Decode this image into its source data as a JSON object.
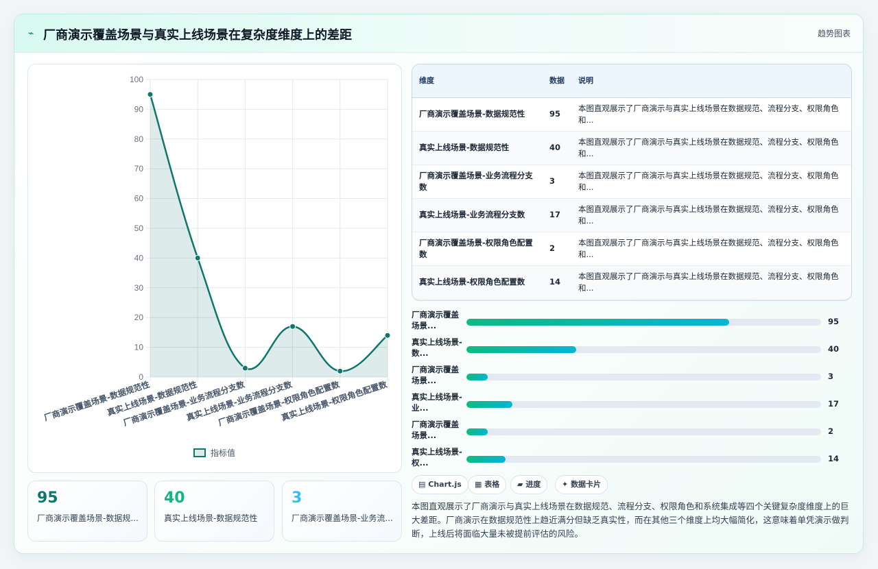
{
  "header": {
    "icon": "line-chart-icon",
    "title": "厂商演示覆盖场景与真实上线场景在复杂度维度上的差距",
    "tag": "趋势图表"
  },
  "chart_data": {
    "type": "line",
    "categories": [
      "厂商演示覆盖场景-数据规范性",
      "真实上线场景-数据规范性",
      "厂商演示覆盖场景-业务流程分支数",
      "真实上线场景-业务流程分支数",
      "厂商演示覆盖场景-权限角色配置数",
      "真实上线场景-权限角色配置数"
    ],
    "series": [
      {
        "name": "指标值",
        "values": [
          95,
          40,
          3,
          17,
          2,
          14
        ]
      }
    ],
    "ylim": [
      0,
      100
    ],
    "yticks": [
      0,
      10,
      20,
      30,
      40,
      50,
      60,
      70,
      80,
      90,
      100
    ],
    "grid": true,
    "fill": true,
    "legend": "bottom",
    "color": "#0f766e"
  },
  "table": {
    "headers": [
      "维度",
      "数据",
      "说明"
    ],
    "rows": [
      {
        "dim": "厂商演示覆盖场景-数据规范性",
        "value": "95",
        "desc": "本图直观展示了厂商演示与真实上线场景在数据规范、流程分支、权限角色和..."
      },
      {
        "dim": "真实上线场景-数据规范性",
        "value": "40",
        "desc": "本图直观展示了厂商演示与真实上线场景在数据规范、流程分支、权限角色和..."
      },
      {
        "dim": "厂商演示覆盖场景-业务流程分支数",
        "value": "3",
        "desc": "本图直观展示了厂商演示与真实上线场景在数据规范、流程分支、权限角色和..."
      },
      {
        "dim": "真实上线场景-业务流程分支数",
        "value": "17",
        "desc": "本图直观展示了厂商演示与真实上线场景在数据规范、流程分支、权限角色和..."
      },
      {
        "dim": "厂商演示覆盖场景-权限角色配置数",
        "value": "2",
        "desc": "本图直观展示了厂商演示与真实上线场景在数据规范、流程分支、权限角色和..."
      },
      {
        "dim": "真实上线场景-权限角色配置数",
        "value": "14",
        "desc": "本图直观展示了厂商演示与真实上线场景在数据规范、流程分支、权限角色和..."
      }
    ]
  },
  "bars": [
    {
      "label": "厂商演示覆盖场景...",
      "value": "95",
      "percent": 74
    },
    {
      "label": "真实上线场景-数...",
      "value": "40",
      "percent": 31
    },
    {
      "label": "厂商演示覆盖场景...",
      "value": "3",
      "percent": 6
    },
    {
      "label": "真实上线场景-业...",
      "value": "17",
      "percent": 13
    },
    {
      "label": "厂商演示覆盖场景...",
      "value": "2",
      "percent": 6
    },
    {
      "label": "真实上线场景-权...",
      "value": "14",
      "percent": 11
    }
  ],
  "stats": [
    {
      "value": "95",
      "label": "厂商演示覆盖场景-数据规...",
      "color": "#0f766e"
    },
    {
      "value": "40",
      "label": "真实上线场景-数据规范性",
      "color": "#10b981"
    },
    {
      "value": "3",
      "label": "厂商演示覆盖场景-业务流...",
      "color": "#38bdf8"
    }
  ],
  "chips": [
    {
      "icon": "chart-icon",
      "glyph": "▤",
      "label": "Chart.js"
    },
    {
      "icon": "table-icon",
      "glyph": "▦",
      "label": "表格"
    },
    {
      "icon": "progress-icon",
      "glyph": "▰",
      "label": "进度"
    },
    {
      "icon": "sparkle-icon",
      "glyph": "✦",
      "label": "数据卡片"
    }
  ],
  "summary": "本图直观展示了厂商演示与真实上线场景在数据规范、流程分支、权限角色和系统集成等四个关键复杂度维度上的巨大差距。厂商演示在数据规范性上趋近满分但缺乏真实性，而在其他三个维度上均大幅简化，这意味着单凭演示做判断，上线后将面临大量未被提前评估的风险。"
}
